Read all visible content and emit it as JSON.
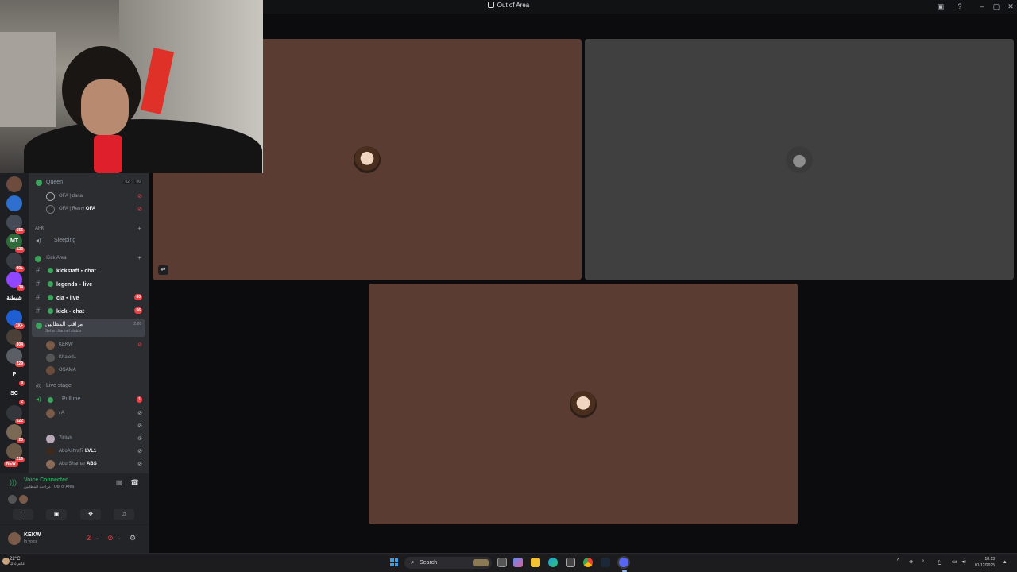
{
  "window": {
    "title": "Out of Area"
  },
  "servers": [
    {
      "label": "",
      "color": "#6d4c3d",
      "badge": ""
    },
    {
      "label": "",
      "color": "#2e6fd0",
      "badge": ""
    },
    {
      "label": "",
      "color": "#444a56",
      "badge": "555"
    },
    {
      "label": "MT",
      "color": "#2f6b3a",
      "badge": "123"
    },
    {
      "label": "",
      "color": "#3a3d44",
      "badge": "99+"
    },
    {
      "label": "",
      "color": "#9146ff",
      "badge": "34"
    },
    {
      "label": "شيطنة",
      "color": "#1e1f22",
      "badge": ""
    },
    {
      "label": "",
      "color": "#1f5fd6",
      "badge": "1K+"
    },
    {
      "label": "",
      "color": "#4b4038",
      "badge": "804"
    },
    {
      "label": "",
      "color": "#5a5f66",
      "badge": "229"
    },
    {
      "label": "P",
      "color": "#1e1f22",
      "badge": "8"
    },
    {
      "label": "SC",
      "color": "#1e1f22",
      "badge": "2"
    },
    {
      "label": "",
      "color": "#33363b",
      "badge": "622"
    },
    {
      "label": "",
      "color": "#7a6a55",
      "badge": "23"
    },
    {
      "label": "",
      "color": "#6b5a48",
      "badge": "219"
    }
  ],
  "new_badge": "NEW",
  "channels": {
    "queen": {
      "name": "Queen",
      "count_a": "02",
      "count_b": "06"
    },
    "queen_users": [
      {
        "name": "OFA | dana"
      },
      {
        "name": "OFA | Remy",
        "tag": "OFA"
      }
    ],
    "afk_category": "AFK",
    "sleeping": "Sleeping",
    "kick_category": "| Kick Area",
    "text_channels": [
      {
        "name": "kickstaff・chat",
        "badge": ""
      },
      {
        "name": "legends・live",
        "badge": ""
      },
      {
        "name": "cia・live",
        "badge": "60"
      },
      {
        "name": "kick・chat",
        "badge": "56"
      }
    ],
    "active_voice": {
      "name": "مراقب المطايين",
      "status": "Set a channel status",
      "time": "2:26"
    },
    "active_users": [
      {
        "name": "KEKW"
      },
      {
        "name": "Khaled.."
      },
      {
        "name": "OSAMA"
      }
    ],
    "live_stage": "Live stage",
    "pull_me": "Pull me",
    "pull_me_badge": "1",
    "stage_users": [
      {
        "name": "/ A"
      },
      {
        "name": ""
      },
      {
        "name": "7lllllah"
      },
      {
        "name": "AboAshraf7",
        "tag": "LVL1"
      },
      {
        "name": "Abu Shamar",
        "tag": "ABS"
      }
    ]
  },
  "voice": {
    "status": "Voice Connected",
    "location": "مراقب المطايين / Out of Area"
  },
  "user": {
    "name": "KEKW",
    "status": "In voice"
  },
  "taskbar": {
    "temperature": "22°C",
    "weather_sub": "غائم غالبًا",
    "search_placeholder": "Search",
    "lang": "ع",
    "time": "18:13",
    "date": "01/12/2025"
  }
}
